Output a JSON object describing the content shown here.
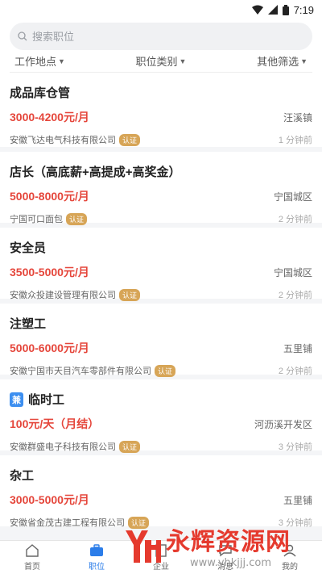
{
  "status": {
    "time": "7:19"
  },
  "search": {
    "placeholder": "搜索职位"
  },
  "filters": [
    {
      "label": "工作地点"
    },
    {
      "label": "职位类别"
    },
    {
      "label": "其他筛选"
    }
  ],
  "jobs": [
    {
      "title": "成品库仓管",
      "tag": "",
      "salary": "3000-4200元/月",
      "location": "汪溪镇",
      "company": "安徽飞达电气科技有限公司",
      "badge": "认证",
      "time": "1 分钟前"
    },
    {
      "title": "店长（高底薪+高提成+高奖金）",
      "tag": "",
      "salary": "5000-8000元/月",
      "location": "宁国城区",
      "company": "宁国可口面包",
      "badge": "认证",
      "time": "2 分钟前"
    },
    {
      "title": "安全员",
      "tag": "",
      "salary": "3500-5000元/月",
      "location": "宁国城区",
      "company": "安徽众投建设管理有限公司",
      "badge": "认证",
      "time": "2 分钟前"
    },
    {
      "title": "注塑工",
      "tag": "",
      "salary": "5000-6000元/月",
      "location": "五里铺",
      "company": "安徽宁国市天目汽车零部件有限公司",
      "badge": "认证",
      "time": "2 分钟前"
    },
    {
      "title": "临时工",
      "tag": "兼",
      "salary": "100元/天（月结）",
      "location": "河沥溪开发区",
      "company": "安徽群盛电子科技有限公司",
      "badge": "认证",
      "time": "3 分钟前"
    },
    {
      "title": "杂工",
      "tag": "",
      "salary": "3000-5000元/月",
      "location": "五里铺",
      "company": "安徽省金茂古建工程有限公司",
      "badge": "认证",
      "time": "3 分钟前"
    }
  ],
  "tabbar": [
    {
      "label": "首页",
      "icon": "home-icon"
    },
    {
      "label": "职位",
      "icon": "briefcase-icon"
    },
    {
      "label": "企业",
      "icon": "building-icon"
    },
    {
      "label": "消息",
      "icon": "message-icon"
    },
    {
      "label": "我的",
      "icon": "user-icon"
    }
  ],
  "watermark": {
    "brand": "永辉资源网",
    "url": "www.yhkjjj.com"
  },
  "colors": {
    "accent": "#2b7de9",
    "salary": "#e5463b",
    "badge": "#d7a557",
    "part_time_tag": "#3d8ff0"
  }
}
